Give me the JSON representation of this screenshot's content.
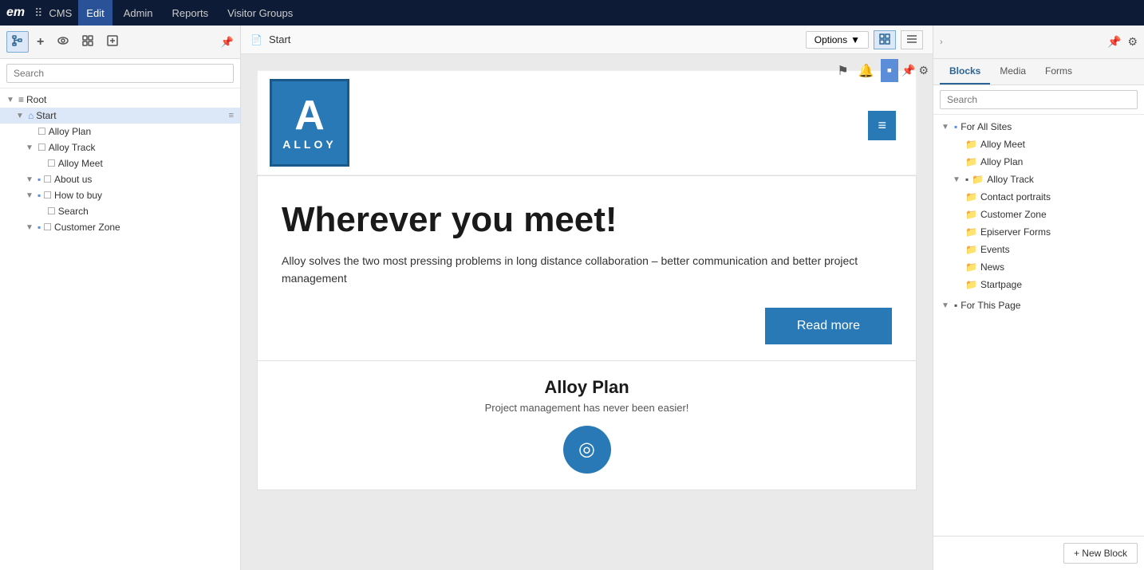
{
  "topNav": {
    "logo": "em",
    "cms_label": "CMS",
    "edit_label": "Edit",
    "admin_label": "Admin",
    "reports_label": "Reports",
    "visitor_groups_label": "Visitor Groups"
  },
  "toolbar": {
    "tree_view_label": "tree-view",
    "add_label": "+",
    "preview_label": "eye",
    "zoom_label": "zoom",
    "add_content_label": "add-content"
  },
  "breadcrumb": {
    "page_icon": "📄",
    "page_name": "Start",
    "options_label": "Options",
    "options_arrow": "▼"
  },
  "leftSidebar": {
    "search_placeholder": "Search",
    "tree": {
      "root_label": "Root",
      "items": [
        {
          "label": "Start",
          "level": 1,
          "type": "home",
          "selected": true
        },
        {
          "label": "Alloy Plan",
          "level": 2,
          "type": "page"
        },
        {
          "label": "Alloy Track",
          "level": 2,
          "type": "folder-expand"
        },
        {
          "label": "Alloy Meet",
          "level": 3,
          "type": "page"
        },
        {
          "label": "About us",
          "level": 2,
          "type": "folder-expand"
        },
        {
          "label": "How to buy",
          "level": 2,
          "type": "folder-expand"
        },
        {
          "label": "Search",
          "level": 3,
          "type": "page"
        },
        {
          "label": "Customer Zone",
          "level": 2,
          "type": "folder-expand"
        }
      ]
    }
  },
  "preview": {
    "brand_letter": "A",
    "brand_name": "ALLOY",
    "hero_title": "Wherever you meet!",
    "hero_desc": "Alloy solves the two most pressing problems in long distance collaboration – better communication and better project management",
    "read_more_label": "Read more",
    "alloy_plan_title": "Alloy Plan",
    "alloy_plan_subtitle": "Project management has never been easier!"
  },
  "rightSidebar": {
    "tabs": {
      "blocks_label": "Blocks",
      "media_label": "Media",
      "forms_label": "Forms"
    },
    "search_placeholder": "Search",
    "tree": {
      "for_all_sites_label": "For All Sites",
      "alloy_meet_label": "Alloy Meet",
      "alloy_plan_label": "Alloy Plan",
      "alloy_track_label": "Alloy Track",
      "contact_portraits_label": "Contact portraits",
      "customer_zone_label": "Customer Zone",
      "episerver_forms_label": "Episerver Forms",
      "events_label": "Events",
      "news_label": "News",
      "startpage_label": "Startpage",
      "for_this_page_label": "For This Page"
    },
    "new_block_label": "+ New Block"
  },
  "icons": {
    "flag": "⚑",
    "bell": "🔔",
    "pin": "📌",
    "gear": "⚙",
    "eye": "👁",
    "tree": "🗂",
    "search": "🔍",
    "grid": "⋮⋮",
    "hamburger": "≡",
    "chevron_down": "▾",
    "expand": "▶",
    "collapse": "▼",
    "folder": "📁",
    "page_doc": "📄",
    "home": "🏠"
  }
}
